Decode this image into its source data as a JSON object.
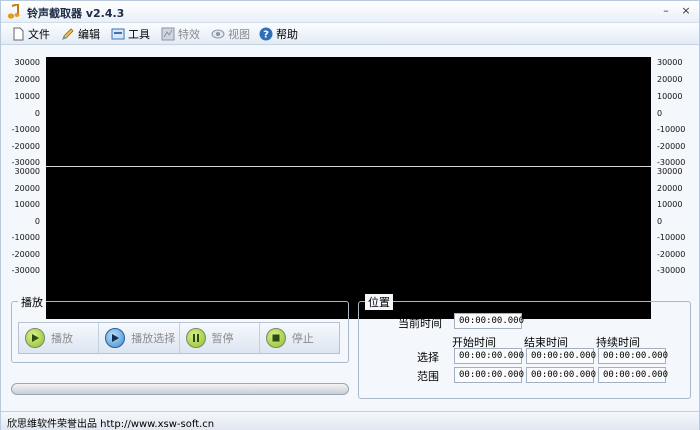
{
  "window": {
    "title": "铃声截取器 v2.4.3"
  },
  "menu": {
    "file": "文件",
    "edit": "编辑",
    "tools": "工具",
    "effects": "特效",
    "view": "视图",
    "help": "帮助"
  },
  "waveform": {
    "ticks_top": [
      "30000",
      "20000",
      "10000",
      "0",
      "-10000",
      "-20000",
      "-30000"
    ],
    "ticks_bottom": [
      "30000",
      "20000",
      "10000",
      "0",
      "-10000",
      "-20000",
      "-30000"
    ]
  },
  "playback": {
    "title": "播放",
    "play": "播放",
    "play_selection": "播放选择",
    "pause": "暂停",
    "stop": "停止",
    "progress": 0
  },
  "position": {
    "title": "位置",
    "current_time_label": "当前时间",
    "current_time": "00:00:00.000",
    "col_start": "开始时间",
    "col_end": "结束时间",
    "col_duration": "持续时间",
    "row_selection": "选择",
    "row_range": "范围",
    "selection_start": "00:00:00.000",
    "selection_end": "00:00:00.000",
    "selection_duration": "00:00:00.000",
    "range_start": "00:00:00.000",
    "range_end": "00:00:00.000",
    "range_duration": "00:00:00.000"
  },
  "status": {
    "text": "欣思维软件荣誉出品 http://www.xsw-soft.cn"
  },
  "colors": {
    "accent": "#2f6fb8",
    "play_green": "#9ccc3a",
    "play_blue": "#3f8fd6"
  }
}
